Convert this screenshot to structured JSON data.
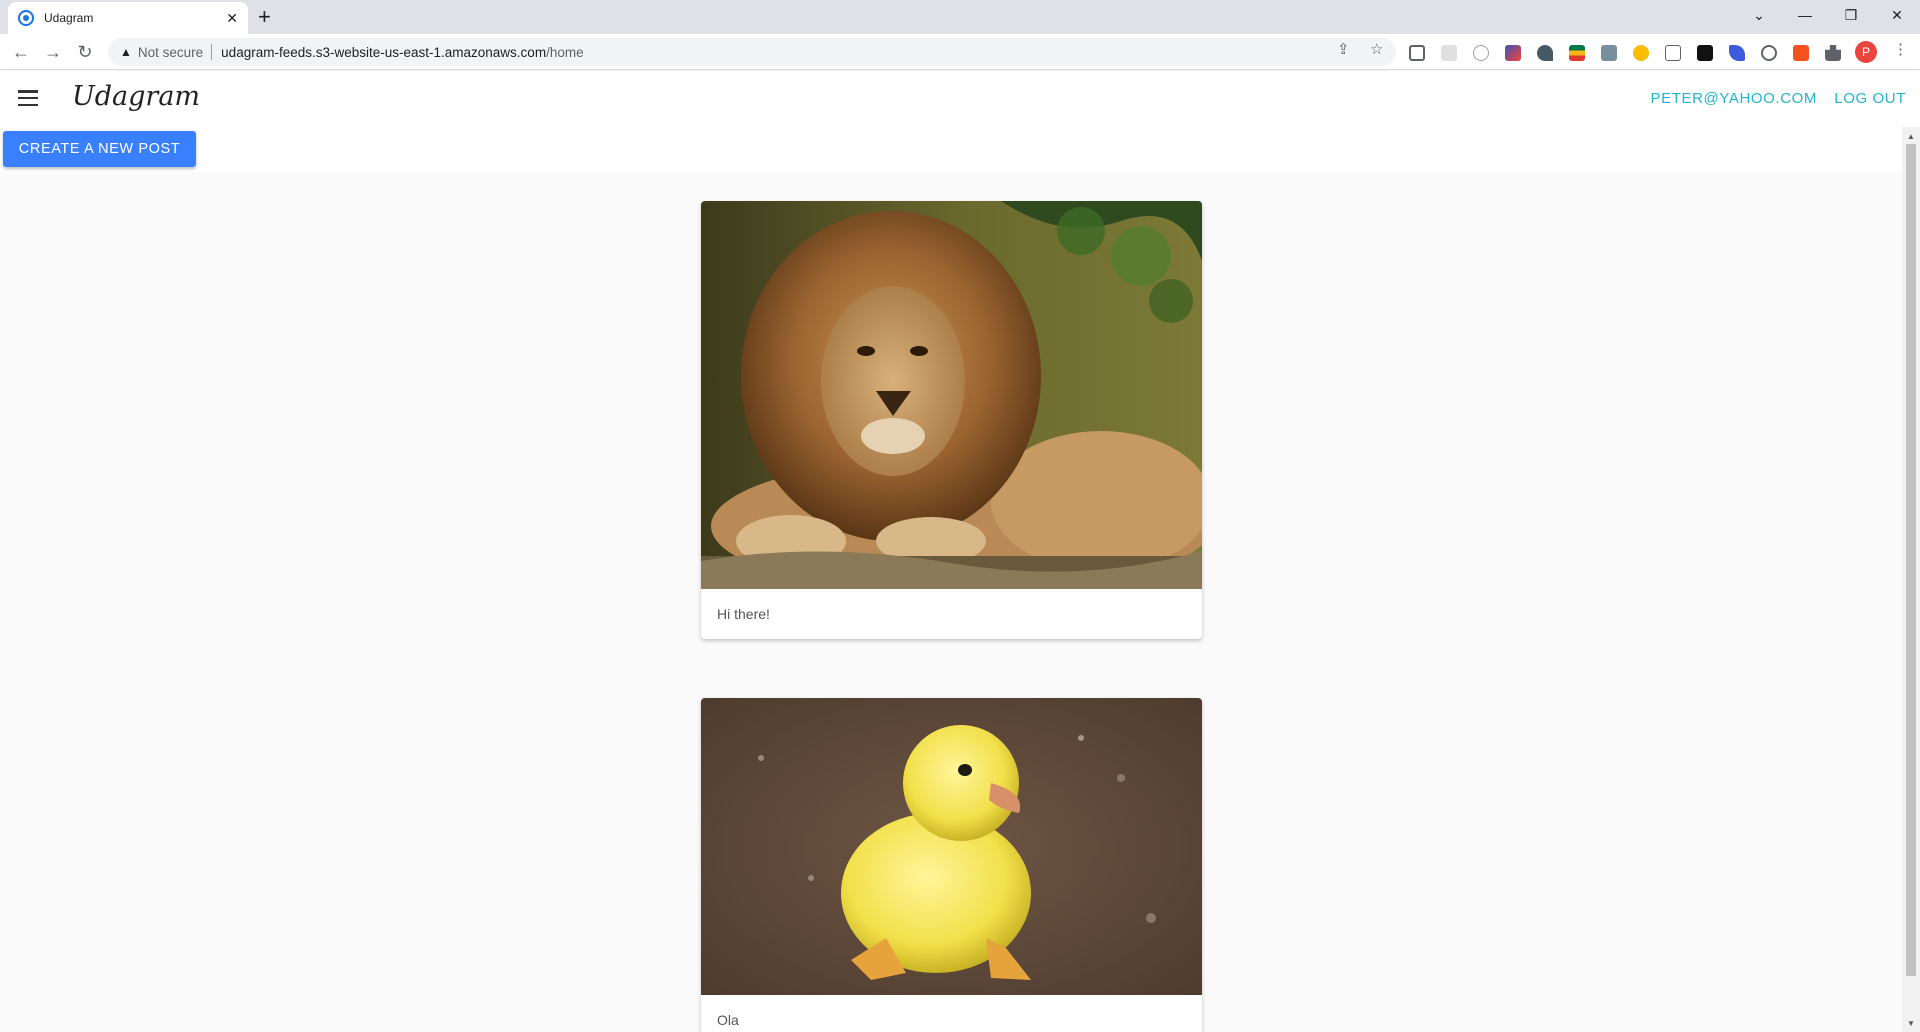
{
  "browser": {
    "tab_title": "Udagram",
    "tab_close": "✕",
    "new_tab": "+",
    "security_label": "Not secure",
    "url_host": "udagram-feeds.s3-website-us-east-1.amazonaws.com",
    "url_path": "/home",
    "profile_initial": "P"
  },
  "header": {
    "brand": "Udagram",
    "user_email": "PETER@YAHOO.COM",
    "logout_label": "LOG OUT"
  },
  "actions": {
    "create_post_label": "CREATE A NEW POST"
  },
  "feed": [
    {
      "caption": "Hi there!",
      "image": "lion photo"
    },
    {
      "caption": "Ola",
      "image": "duckling photo"
    }
  ],
  "colors": {
    "accent": "#3880ff",
    "link": "#22b4cf"
  }
}
